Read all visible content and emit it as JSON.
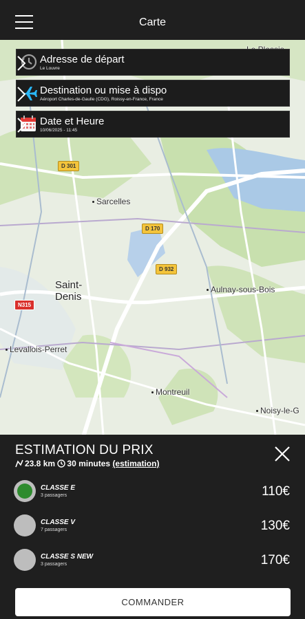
{
  "header": {
    "title": "Carte"
  },
  "route": {
    "departure": {
      "label": "Adresse de départ",
      "value": "Le Louvre"
    },
    "destination": {
      "label": "Destination ou mise à dispo",
      "value": "Aéroport Charles-de-Gaulle (CDG), Roissy-en-France, France"
    },
    "datetime": {
      "label": "Date et Heure",
      "value": "10/06/2025 - 11:45"
    }
  },
  "map": {
    "labels": {
      "le_plessis": "Le Plessis",
      "sarcelles": "Sarcelles",
      "saint_denis_1": "Saint-",
      "saint_denis_2": "Denis",
      "aulnay": "Aulnay-sous-Bois",
      "levallois": "Levallois-Perret",
      "montreuil": "Montreuil",
      "noisy": "Noisy-le-G"
    },
    "roads": {
      "d301": "D 301",
      "d170": "D 170",
      "d932": "D 932",
      "n315": "N315"
    }
  },
  "estimate": {
    "title": "ESTIMATION DU PRIX",
    "distance": "23.8 km",
    "duration": "30 minutes",
    "estimation_link": "(estimation)",
    "classes": [
      {
        "name": "CLASSE E",
        "passengers": "3 passagers",
        "price": "110€",
        "selected": true
      },
      {
        "name": "CLASSE V",
        "passengers": "7 passagers",
        "price": "130€",
        "selected": false
      },
      {
        "name": "CLASSE S NEW",
        "passengers": "3 passagers",
        "price": "170€",
        "selected": false
      }
    ],
    "order_label": "COMMANDER"
  },
  "colors": {
    "accent_selected": "#2e8b2e",
    "sheet_bg": "#1f1f1f"
  }
}
